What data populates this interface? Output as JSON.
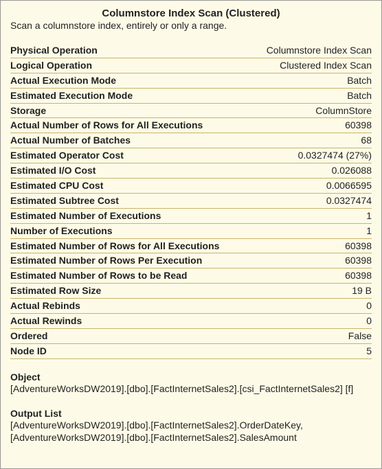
{
  "header": {
    "title": "Columnstore Index Scan (Clustered)",
    "description": "Scan a columnstore index, entirely or only a range."
  },
  "properties": [
    {
      "label": "Physical Operation",
      "value": "Columnstore Index Scan"
    },
    {
      "label": "Logical Operation",
      "value": "Clustered Index Scan"
    },
    {
      "label": "Actual Execution Mode",
      "value": "Batch"
    },
    {
      "label": "Estimated Execution Mode",
      "value": "Batch"
    },
    {
      "label": "Storage",
      "value": "ColumnStore"
    },
    {
      "label": "Actual Number of Rows for All Executions",
      "value": "60398"
    },
    {
      "label": "Actual Number of Batches",
      "value": "68"
    },
    {
      "label": "Estimated Operator Cost",
      "value": "0.0327474 (27%)"
    },
    {
      "label": "Estimated I/O Cost",
      "value": "0.026088"
    },
    {
      "label": "Estimated CPU Cost",
      "value": "0.0066595"
    },
    {
      "label": "Estimated Subtree Cost",
      "value": "0.0327474"
    },
    {
      "label": "Estimated Number of Executions",
      "value": "1"
    },
    {
      "label": "Number of Executions",
      "value": "1"
    },
    {
      "label": "Estimated Number of Rows for All Executions",
      "value": "60398"
    },
    {
      "label": "Estimated Number of Rows Per Execution",
      "value": "60398"
    },
    {
      "label": "Estimated Number of Rows to be Read",
      "value": "60398"
    },
    {
      "label": "Estimated Row Size",
      "value": "19 B"
    },
    {
      "label": "Actual Rebinds",
      "value": "0"
    },
    {
      "label": "Actual Rewinds",
      "value": "0"
    },
    {
      "label": "Ordered",
      "value": "False"
    },
    {
      "label": "Node ID",
      "value": "5"
    }
  ],
  "sections": {
    "object": {
      "heading": "Object",
      "body": "[AdventureWorksDW2019].[dbo].[FactInternetSales2].[csi_FactInternetSales2] [f]"
    },
    "output_list": {
      "heading": "Output List",
      "body": "[AdventureWorksDW2019].[dbo].[FactInternetSales2].OrderDateKey, [AdventureWorksDW2019].[dbo].[FactInternetSales2].SalesAmount"
    }
  }
}
